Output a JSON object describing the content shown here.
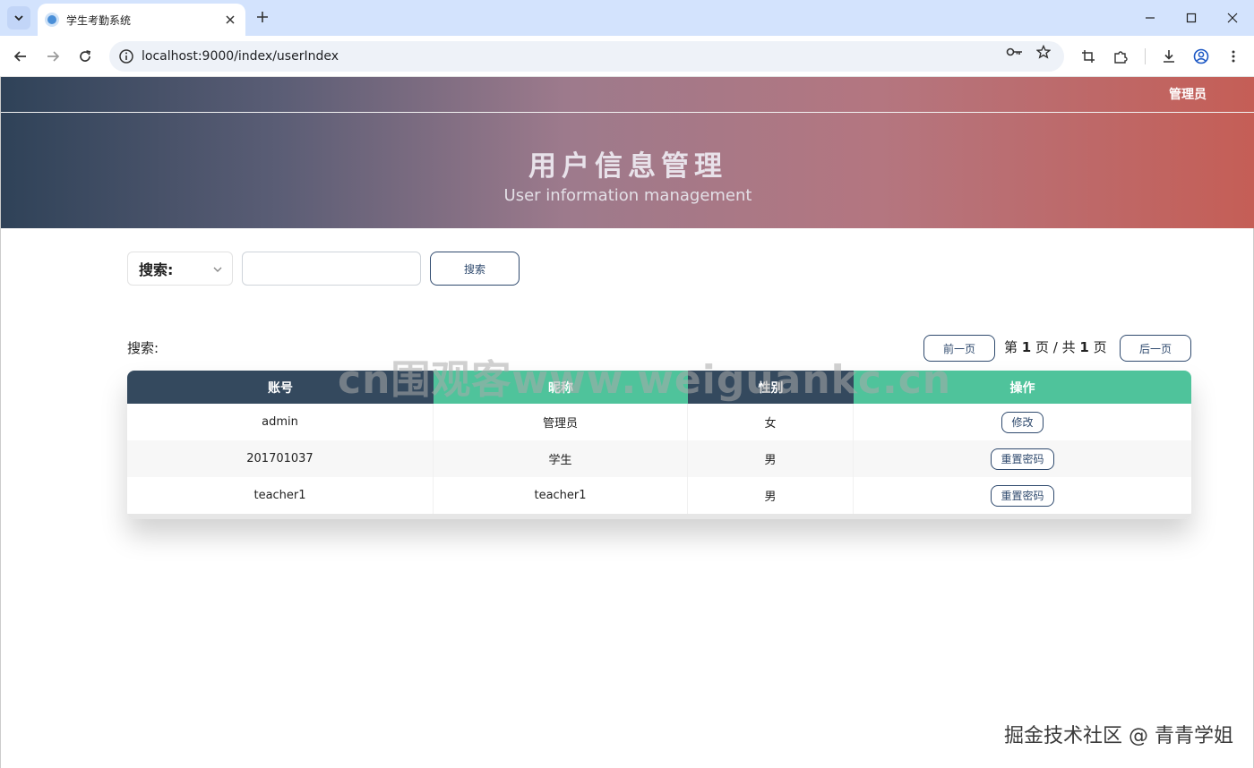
{
  "browser": {
    "tab_title": "学生考勤系统",
    "url": "localhost:9000/index/userIndex"
  },
  "header": {
    "user_label": "管理员",
    "title": "用户信息管理",
    "subtitle": "User information management"
  },
  "search": {
    "select_label": "搜索:",
    "input_value": "",
    "button_label": "搜索"
  },
  "list": {
    "label": "搜索:",
    "prev_label": "前一页",
    "next_label": "后一页",
    "page_prefix": "第",
    "current_page": "1",
    "page_mid": "页 / 共",
    "total_pages": "1",
    "page_suffix": "页"
  },
  "table": {
    "columns": [
      "账号",
      "昵称",
      "性别",
      "操作"
    ],
    "rows": [
      {
        "account": "admin",
        "nickname": "管理员",
        "gender": "女",
        "action": "修改"
      },
      {
        "account": "201701037",
        "nickname": "学生",
        "gender": "男",
        "action": "重置密码"
      },
      {
        "account": "teacher1",
        "nickname": "teacher1",
        "gender": "男",
        "action": "重置密码"
      }
    ]
  },
  "overlay": {
    "watermark": "cn围观客www.weiguankc.cn",
    "credit": "掘金技术社区 @ 青青学姐"
  },
  "colors": {
    "header_dark": "#34495e",
    "header_green": "#4fc39b",
    "button_border": "#2f4a6e"
  }
}
